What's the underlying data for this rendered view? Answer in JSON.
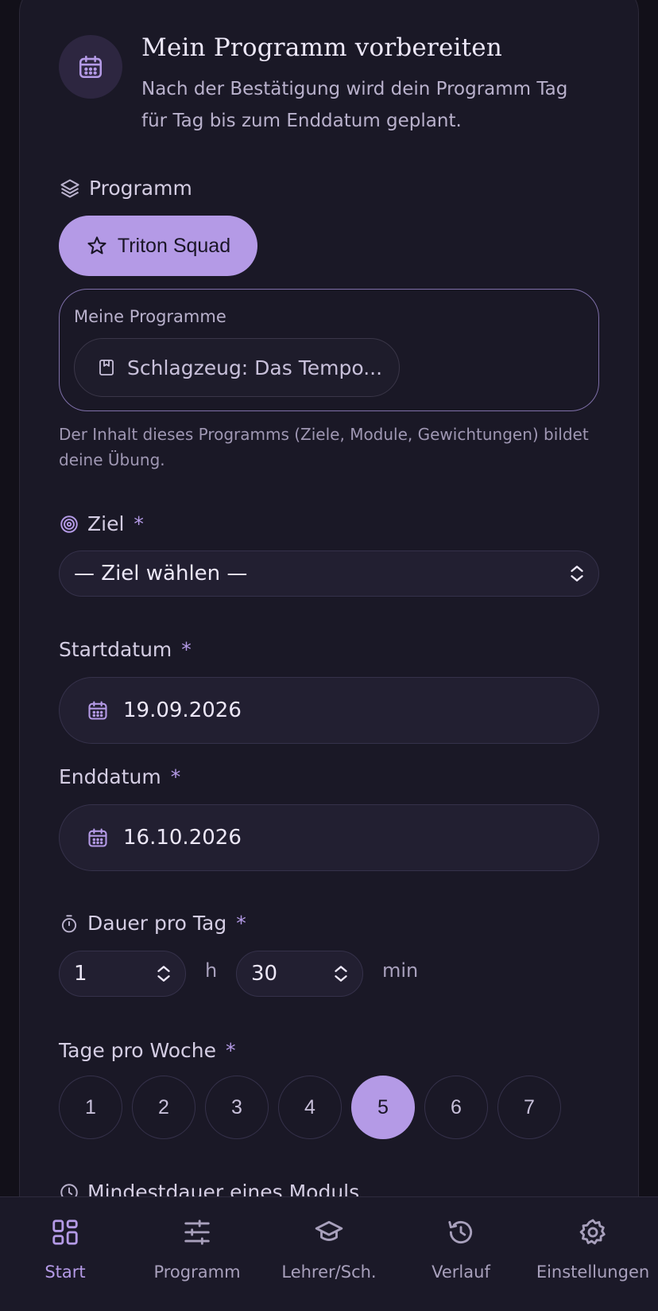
{
  "header": {
    "title": "Mein Programm vorbereiten",
    "subtitle": "Nach der Bestätigung wird dein Programm Tag für Tag bis zum Enddatum geplant."
  },
  "program": {
    "label": "Programm",
    "selected_chip": "Triton Squad",
    "my_programs_title": "Meine Programme",
    "my_program_item": "Schlagzeug: Das Tempo...",
    "hint": "Der Inhalt dieses Programms (Ziele, Module, Gewichtungen) bildet deine Übung."
  },
  "goal": {
    "label": "Ziel",
    "required_mark": "*",
    "placeholder": "— Ziel wählen —"
  },
  "start_date": {
    "label": "Startdatum",
    "required_mark": "*",
    "value": "19.09.2026"
  },
  "end_date": {
    "label": "Enddatum",
    "required_mark": "*",
    "value": "16.10.2026"
  },
  "duration": {
    "label": "Dauer pro Tag",
    "required_mark": "*",
    "hours_value": "1",
    "hours_unit": "h",
    "minutes_value": "30",
    "minutes_unit": "min"
  },
  "days_per_week": {
    "label": "Tage pro Woche",
    "required_mark": "*",
    "options": [
      "1",
      "2",
      "3",
      "4",
      "5",
      "6",
      "7"
    ],
    "selected": "5"
  },
  "min_module": {
    "label": "Mindestdauer eines Moduls"
  },
  "tabbar": {
    "items": [
      {
        "label": "Start",
        "icon": "grid-icon"
      },
      {
        "label": "Programm",
        "icon": "sliders-icon"
      },
      {
        "label": "Lehrer/Sch.",
        "icon": "graduation-cap-icon"
      },
      {
        "label": "Verlauf",
        "icon": "history-icon"
      },
      {
        "label": "Einstellungen",
        "icon": "gear-icon"
      }
    ],
    "active": "Start"
  },
  "colors": {
    "accent": "#b49ae6",
    "background": "#121019",
    "card": "#1a1826"
  }
}
